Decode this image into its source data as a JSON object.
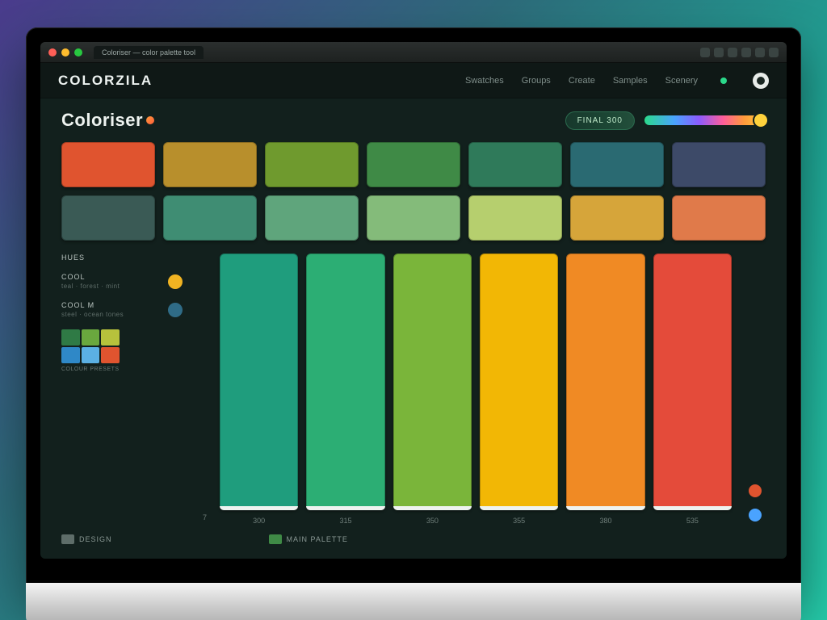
{
  "browser": {
    "tab_title": "Coloriser — color palette tool",
    "url": "coloriser.app/palettes"
  },
  "header": {
    "brand": "COLORZILA",
    "nav": [
      "Swatches",
      "Groups",
      "Create",
      "Samples",
      "Scenery"
    ]
  },
  "page": {
    "title": "Coloriser",
    "badge": "FINAL 300"
  },
  "swatches_row1": [
    "#e0542f",
    "#b88f2c",
    "#6f9a2e",
    "#3f8a46",
    "#2f7a5a",
    "#2a6a72",
    "#3d4a68"
  ],
  "swatches_row2": [
    "#3a5a55",
    "#3f8d73",
    "#5fa57c",
    "#84bb7a",
    "#b6cf6e",
    "#d6a53a",
    "#e07a4a"
  ],
  "side": {
    "label_top": "HUES",
    "group1_title": "COOL",
    "group1_sub": "teal · forest · mint",
    "group1_color": "#f0b322",
    "group2_title": "COOL M",
    "group2_sub": "steel · ocean tones",
    "group2_color": "#2f6b86",
    "mini": [
      "#2f7a45",
      "#6aa83e",
      "#b7c23c",
      "#2f88c7",
      "#5bb0e3",
      "#e0542f"
    ],
    "mini_caption": "COLOUR PRESETS"
  },
  "tall_swatches": [
    "#1f9d7d",
    "#2cae74",
    "#7ab53a",
    "#f2b705",
    "#f08a24",
    "#e44b3a"
  ],
  "axis_left_tick": "7",
  "axis_ticks": [
    "300",
    "315",
    "350",
    "355",
    "380",
    "535"
  ],
  "right_dots": [
    "#e0542f",
    "#4aa3ff"
  ],
  "footer": {
    "legend1_label": "DESIGN",
    "legend1_color": "#5e6d69",
    "legend2_label": "MAIN PALETTE",
    "legend2_color": "#3f8a46"
  },
  "chart_data": {
    "type": "bar",
    "categories": [
      "300",
      "315",
      "350",
      "355",
      "380",
      "535"
    ],
    "series": [
      {
        "name": "hue",
        "colors": [
          "#1f9d7d",
          "#2cae74",
          "#7ab53a",
          "#f2b705",
          "#f08a24",
          "#e44b3a"
        ]
      }
    ],
    "title": "Coloriser",
    "xlabel": "",
    "ylabel": "",
    "ylim": [
      0,
      1
    ]
  }
}
